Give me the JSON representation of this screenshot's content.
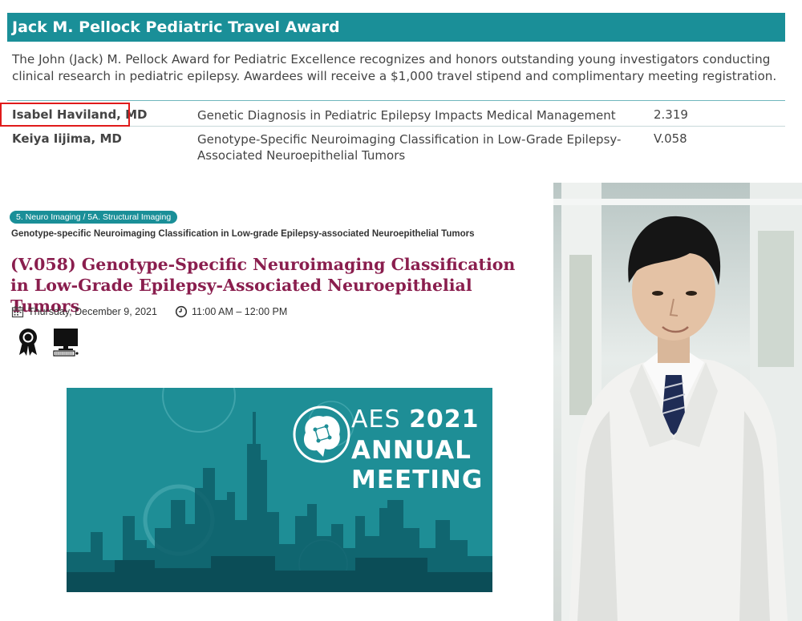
{
  "award": {
    "title": "Jack M. Pellock Pediatric Travel Award",
    "description": "The John (Jack) M. Pellock Award for Pediatric Excellence recognizes and honors outstanding young investigators conducting clinical research in pediatric epilepsy. Awardees will receive a $1,000 travel stipend and complimentary meeting registration.",
    "rows": [
      {
        "name": "Isabel Haviland, MD",
        "topic": "Genetic Diagnosis in Pediatric Epilepsy Impacts Medical Management",
        "code": "2.319"
      },
      {
        "name": "Keiya Iijima, MD",
        "topic": "Genotype-Specific Neuroimaging Classification in Low-Grade Epilepsy-Associated Neuroepithelial Tumors",
        "code": "V.058"
      }
    ],
    "highlight_color": "#e01a1a"
  },
  "abstract": {
    "category_tag": "5. Neuro Imaging / 5A. Structural Imaging",
    "subtitle": "Genotype-specific Neuroimaging Classification in Low-grade Epilepsy-associated Neuroepithelial Tumors",
    "title": "(V.058) Genotype-Specific Neuroimaging Classification in Low-Grade Epilepsy-Associated Neuroepithelial Tumors",
    "date": "Thursday, December 9, 2021",
    "time": "11:00 AM – 12:00 PM",
    "icons": [
      "award-ribbon-icon",
      "computer-monitor-icon"
    ]
  },
  "banner": {
    "line1_prefix": "AES ",
    "line1_year": "2021",
    "line2": "ANNUAL",
    "line3": "MEETING"
  },
  "colors": {
    "teal": "#1a8f98",
    "title_maroon": "#8a1e4e",
    "banner_bg": "#1e8e96"
  }
}
